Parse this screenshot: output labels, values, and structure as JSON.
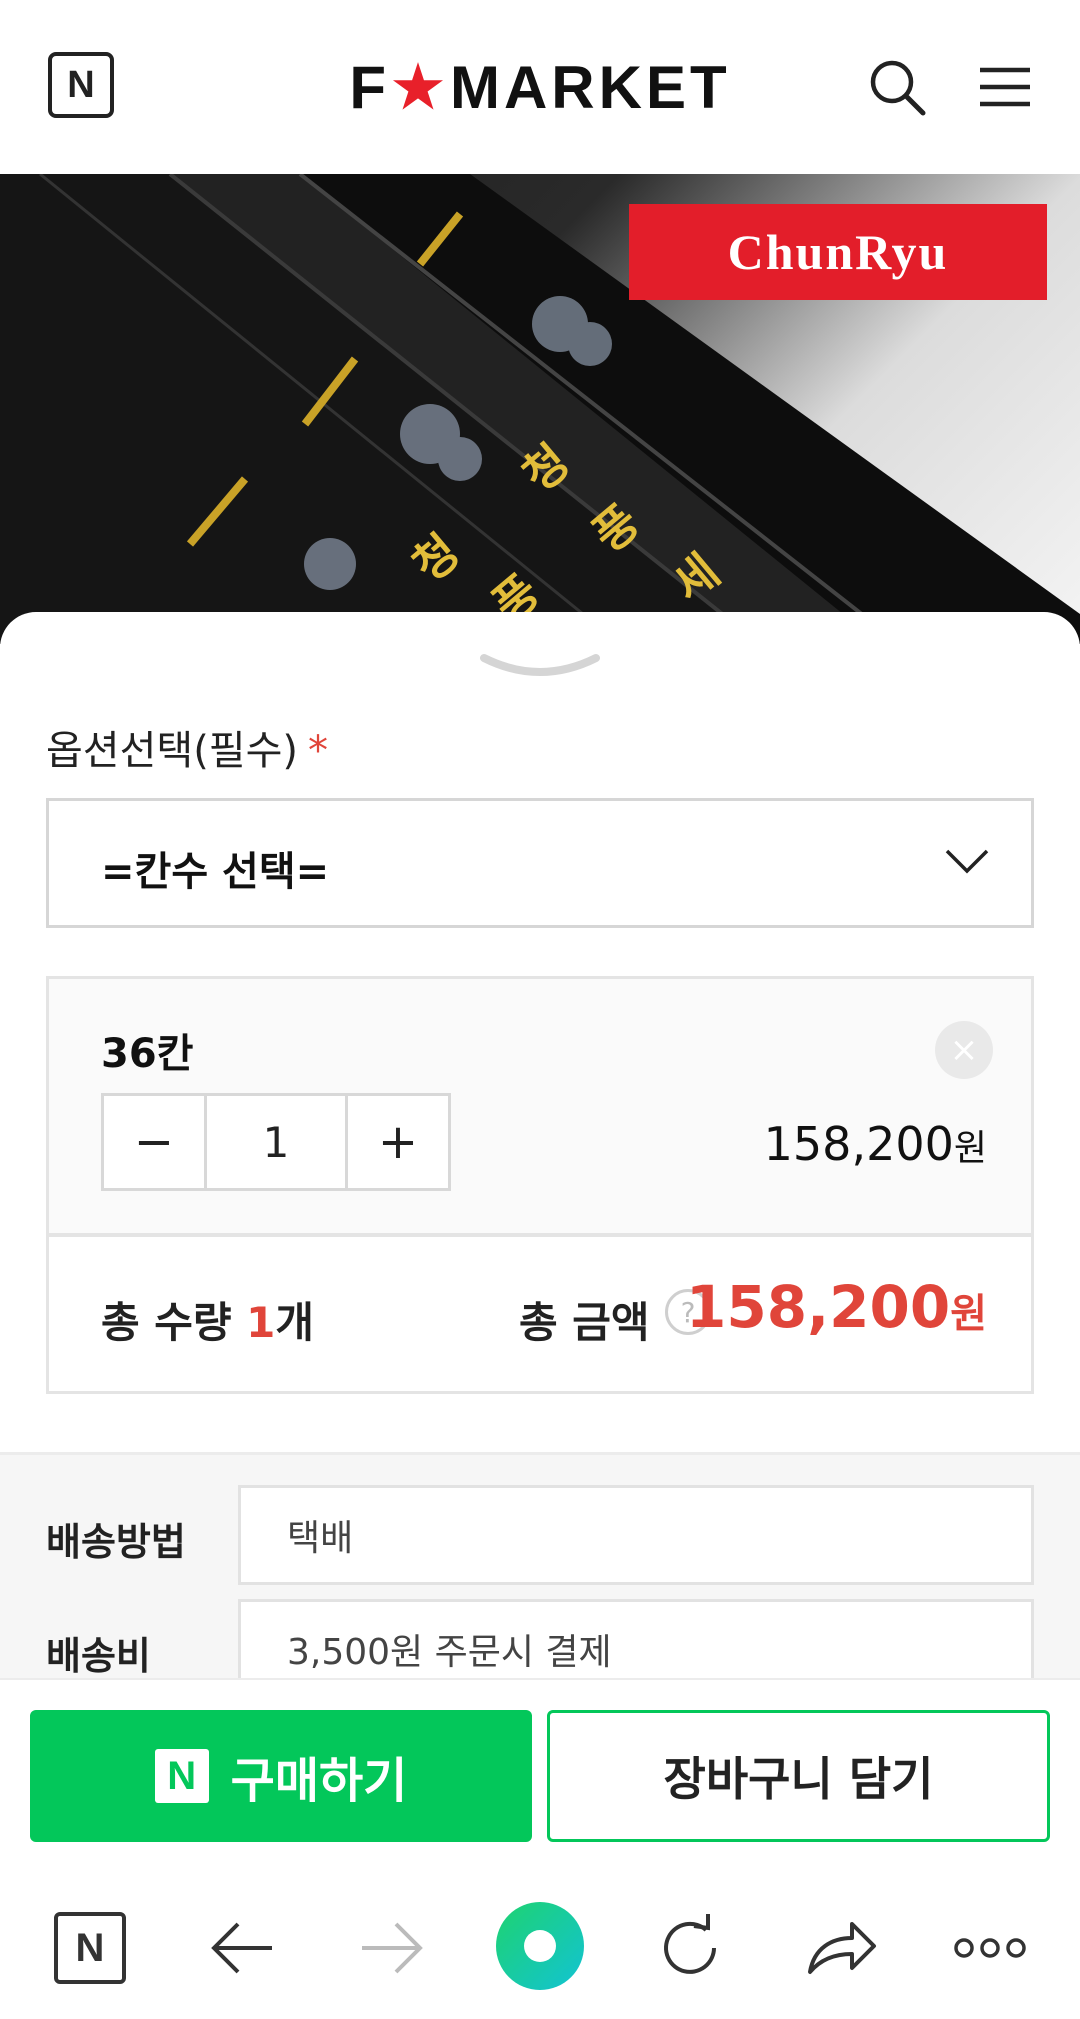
{
  "header": {
    "home_badge": "N",
    "logo_left": "F",
    "logo_star": "★",
    "logo_right": "MARKET"
  },
  "hero": {
    "brand_logo": "ChunRyu"
  },
  "option": {
    "label": "옵션선택(필수)",
    "required_mark": "*",
    "select_value": "=칸수 선택="
  },
  "selected_item": {
    "name": "36칸",
    "quantity": "1",
    "price": "158,200",
    "price_unit": "원",
    "remove_icon": "×",
    "minus": "−",
    "plus": "+"
  },
  "total": {
    "qty_label": "총 수량 ",
    "qty_num": "1",
    "qty_unit": "개",
    "amount_label": "총 금액",
    "help": "?",
    "price": "158,200",
    "price_unit": "원"
  },
  "shipping": {
    "method_label": "배송방법",
    "method_value": "택배",
    "fee_label": "배송비",
    "fee_value": "3,500원 주문시 결제"
  },
  "actions": {
    "buy_badge": "N",
    "buy_label": "구매하기",
    "cart_label": "장바구니 담기"
  },
  "toolbar": {
    "home_badge": "N"
  },
  "colors": {
    "accent_green": "#03c75a",
    "price_red": "#e0453a",
    "brand_red": "#e31e2a"
  }
}
